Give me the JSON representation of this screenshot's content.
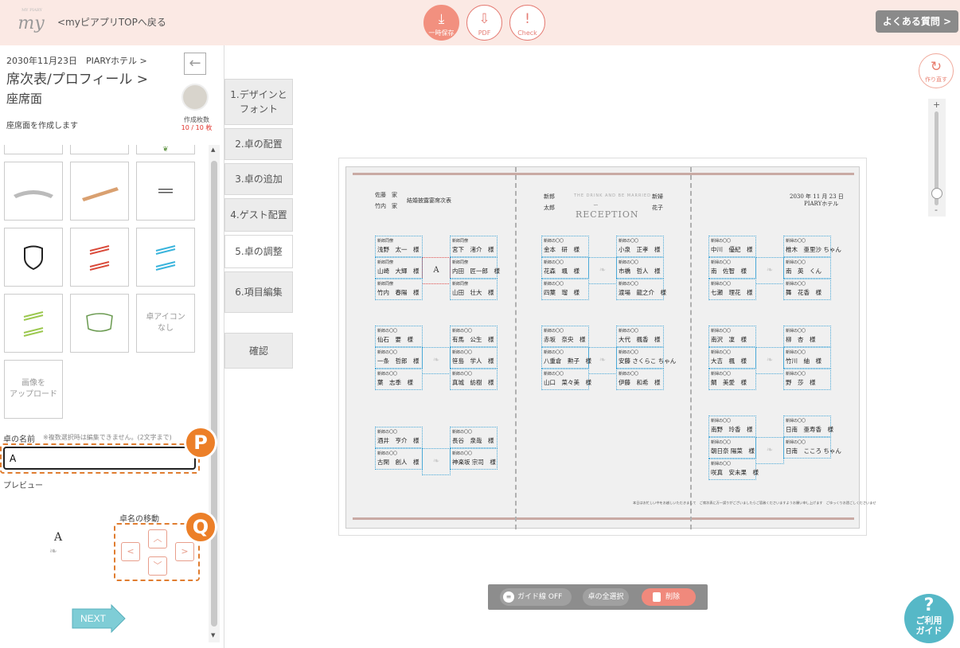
{
  "topbar": {
    "logo_text": "my",
    "logo_small": "MY PIARY",
    "back_link": "<myピアプリTOPへ戻る",
    "tools": [
      {
        "label": "一時保存",
        "icon": "download-icon"
      },
      {
        "label": "PDF",
        "icon": "pdf-download-icon"
      },
      {
        "label": "Check",
        "icon": "exclamation-icon"
      }
    ],
    "faq": "よくある質問 >"
  },
  "left": {
    "date": "2030年11月23日　PIARYホテル >",
    "title1": "席次表/プロフィール >",
    "title2": "座席面",
    "desc": "座席面を作成します",
    "count_label": "作成枚数",
    "count_value": "10 / 10 枚",
    "no_icon_label": "卓アイコン\nなし",
    "upload_label": "画像を\nアップロード",
    "table_name_label": "卓の名前",
    "table_name_note": "※複数選択時は編集できません。(2文字まで)",
    "table_name_value": "A",
    "preview_label": "プレビュー",
    "preview_text": "A",
    "move_label": "卓名の移動",
    "next_label": "NEXT",
    "badges": [
      "P",
      "Q"
    ]
  },
  "steps": [
    "1.デザインと\nフォント",
    "2.卓の配置",
    "3.卓の追加",
    "4.ゲスト配置",
    "5.卓の調整",
    "6.項目編集"
  ],
  "confirm_label": "確認",
  "redo_label": "作り直す",
  "zoom": {
    "plus": "+",
    "minus": "-"
  },
  "sheet": {
    "groom_family": "佐藤　家",
    "bride_family": "竹内　家",
    "ceremony_title": "結婚披露宴席次表",
    "groom_label": "新郎",
    "groom_name": "太郎",
    "bride_label": "新婦",
    "bride_name": "花子",
    "reception_sub": "THE DRINK AND BE MARRIED",
    "reception": "RECEPTION",
    "event_date": "2030 年 11 月 23 日",
    "event_venue": "PIARYホテル",
    "footer_note": "本日はお忙しい中をお越しいただきまして　ご席次表に万一誤りがございましたらご容赦くださいますようお願い申し上げます　ごゆっくりお過ごしくださいませ",
    "tables": [
      {
        "table": "A",
        "selected": true,
        "guests": [
          {
            "title": "新郎同僚",
            "name": "浅野　太一　様"
          },
          {
            "title": "新郎同僚",
            "name": "宮下　渚介　様"
          },
          {
            "title": "新郎同僚",
            "name": "山崎　大輝　様"
          },
          {
            "title": "新郎同僚",
            "name": "内田　匠一郎　様"
          },
          {
            "title": "新郎同僚",
            "name": "竹内　春陽　様"
          },
          {
            "title": "新郎同僚",
            "name": "山田　壮大　様"
          }
        ]
      },
      {
        "table": "",
        "guests": [
          {
            "title": "新郎の〇〇",
            "name": "金本　研　様"
          },
          {
            "title": "新郎の〇〇",
            "name": "小泉　正孝　様"
          },
          {
            "title": "新郎の〇〇",
            "name": "花森　颯　様"
          },
          {
            "title": "新郎の〇〇",
            "name": "市橋　哲人　様"
          },
          {
            "title": "新郎の〇〇",
            "name": "四葉　瑠　様"
          },
          {
            "title": "新郎の〇〇",
            "name": "渡場　龍之介　様"
          }
        ]
      },
      {
        "table": "",
        "guests": [
          {
            "title": "新婦の〇〇",
            "name": "中川　優紀　様"
          },
          {
            "title": "新婦の〇〇",
            "name": "椎木　亜里沙 ちゃん"
          },
          {
            "title": "新婦の〇〇",
            "name": "南　佐智　様"
          },
          {
            "title": "新婦の〇〇",
            "name": "南　英　くん"
          },
          {
            "title": "新婦の〇〇",
            "name": "七瀬　理花　様"
          },
          {
            "title": "新婦の〇〇",
            "name": "舞　花香　様"
          }
        ]
      },
      {
        "table": "",
        "guests": [
          {
            "title": "新郎の〇〇",
            "name": "仙石　要　様"
          },
          {
            "title": "新郎の〇〇",
            "name": "有馬　公生　様"
          },
          {
            "title": "新郎の〇〇",
            "name": "一条　哲郎　様"
          },
          {
            "title": "新郎の〇〇",
            "name": "笹島　学人　様"
          },
          {
            "title": "新郎の〇〇",
            "name": "葉　志季　様"
          },
          {
            "title": "新郎の〇〇",
            "name": "真城　紡樹　様"
          }
        ]
      },
      {
        "table": "",
        "guests": [
          {
            "title": "新郎の〇〇",
            "name": "赤坂　奈央　様"
          },
          {
            "title": "新郎の〇〇",
            "name": "大代　楓香　様"
          },
          {
            "title": "新郎の〇〇",
            "name": "八重倉　勲子　様"
          },
          {
            "title": "新郎の〇〇",
            "name": "安藤 さくらこ ちゃん"
          },
          {
            "title": "新郎の〇〇",
            "name": "山口　菜々美　様"
          },
          {
            "title": "新郎の〇〇",
            "name": "伊藤　和希　様"
          }
        ]
      },
      {
        "table": "",
        "guests": [
          {
            "title": "新婦の〇〇",
            "name": "南沢　凜　様"
          },
          {
            "title": "新婦の〇〇",
            "name": "柳　杏　様"
          },
          {
            "title": "新婦の〇〇",
            "name": "大吉　楓　様"
          },
          {
            "title": "新婦の〇〇",
            "name": "竹川　紬　様"
          },
          {
            "title": "新婦の〇〇",
            "name": "鯛　美愛　様"
          },
          {
            "title": "新婦の〇〇",
            "name": "野　莎　様"
          }
        ]
      },
      {
        "table": "",
        "guests": [
          {
            "title": "新郎の〇〇",
            "name": "酒井　亨介　様"
          },
          {
            "title": "新郎の〇〇",
            "name": "長谷　泉哉　様"
          },
          {
            "title": "新郎の〇〇",
            "name": "古閑　創人　様"
          },
          {
            "title": "新郎の〇〇",
            "name": "神楽坂 宗司　様"
          }
        ]
      },
      {
        "table": "",
        "guests": [
          {
            "title": "新婦の〇〇",
            "name": "南野　玲香　様"
          },
          {
            "title": "新婦の〇〇",
            "name": "日南　亜寿香　様"
          },
          {
            "title": "新婦の〇〇",
            "name": "朝日奈 陽菜　様"
          },
          {
            "title": "新婦の〇〇",
            "name": "日南　こころ ちゃん"
          },
          {
            "title": "新婦の〇〇",
            "name": "咲真　安未果　様"
          }
        ]
      }
    ]
  },
  "bottom_bar": {
    "guide": "ガイド線 OFF",
    "select_all": "卓の全選択",
    "delete": "削除"
  },
  "help": {
    "q": "?",
    "label": "ご利用\nガイド"
  },
  "colors": {
    "accent": "#f2907f",
    "badge": "#ec7f28",
    "guest_border": "#4aa9d8",
    "help": "#56b8c7"
  }
}
